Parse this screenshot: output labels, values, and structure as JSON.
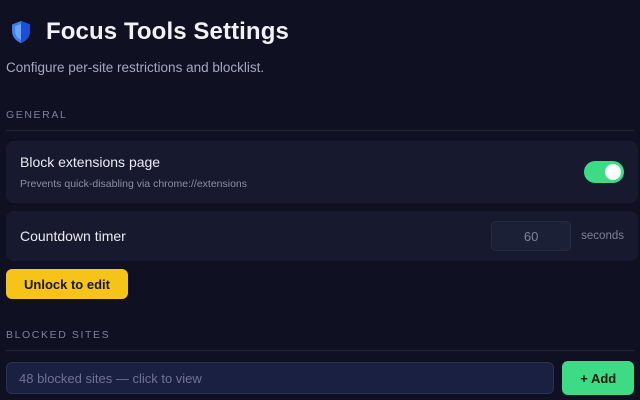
{
  "header": {
    "title": "Focus Tools Settings",
    "subtitle": "Configure per-site restrictions and blocklist.",
    "icon": "shield-icon"
  },
  "general": {
    "section_label": "GENERAL",
    "block_extensions": {
      "title": "Block extensions page",
      "description": "Prevents quick-disabling via chrome://extensions",
      "enabled": true
    },
    "countdown": {
      "title": "Countdown timer",
      "value": "60",
      "unit": "seconds"
    },
    "unlock_label": "Unlock to edit"
  },
  "blocked": {
    "section_label": "BLOCKED SITES",
    "summary": "48 blocked sites — click to view",
    "add_label": "+ Add"
  },
  "colors": {
    "background": "#0f1123",
    "card": "#171a2e",
    "accent_green": "#3ddc84",
    "accent_yellow": "#f6c419"
  }
}
